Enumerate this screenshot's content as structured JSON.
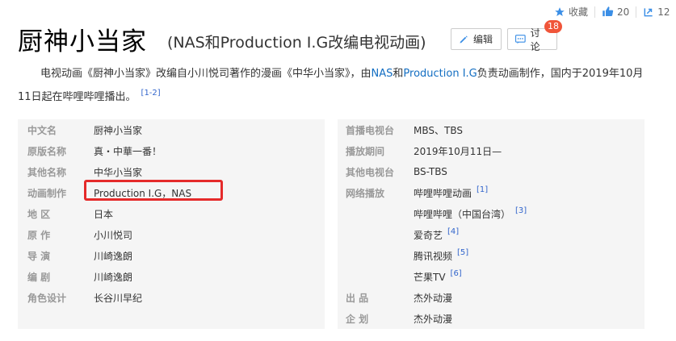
{
  "top_actions": {
    "favorite_label": "收藏",
    "like_count": "20",
    "share_count": "12"
  },
  "header": {
    "title": "厨神小当家",
    "subtitle": "(NAS和Production I.G改编电视动画)",
    "edit_label": "编辑",
    "discuss_label": "讨论",
    "discuss_badge": "18"
  },
  "summary": {
    "t1": "电视动画《厨神小当家》改编自小川悦司著作的漫画《中华小当家》，由",
    "link1": "NAS",
    "t2": "和",
    "link2": "Production I.G",
    "t3": "负责动画制作，国内于2019年10月11日起在哔哩哔哩播出。",
    "ref": "[1-2]"
  },
  "info": {
    "left": [
      {
        "key": "中文名",
        "value": "厨神小当家"
      },
      {
        "key": "原版名称",
        "value": "真・中華一番！"
      },
      {
        "key": "其他名称",
        "value": "中华小当家"
      },
      {
        "key": "动画制作",
        "value": "Production I.G，NAS"
      },
      {
        "key": "地 区",
        "value": "日本"
      },
      {
        "key": "原 作",
        "value": "小川悦司"
      },
      {
        "key": "导 演",
        "value": "川崎逸朗"
      },
      {
        "key": "编 剧",
        "value": "川崎逸朗"
      },
      {
        "key": "角色设计",
        "value": "长谷川早纪"
      }
    ],
    "right": [
      {
        "key": "首播电视台",
        "value": "MBS、TBS",
        "ref": ""
      },
      {
        "key": "播放期间",
        "value": "2019年10月11日—",
        "ref": ""
      },
      {
        "key": "其他电视台",
        "value": "BS-TBS",
        "ref": ""
      },
      {
        "key": "网络播放",
        "value": "哔哩哔哩动画",
        "ref": "[1]"
      },
      {
        "key": "",
        "value": "哔哩哔哩（中国台湾）",
        "ref": "[3]"
      },
      {
        "key": "",
        "value": "爱奇艺",
        "ref": "[4]"
      },
      {
        "key": "",
        "value": "腾讯视频",
        "ref": "[5]"
      },
      {
        "key": "",
        "value": "芒果TV",
        "ref": "[6]"
      },
      {
        "key": "出 品",
        "value": "杰外动漫",
        "ref": ""
      },
      {
        "key": "企 划",
        "value": "杰外动漫",
        "ref": ""
      }
    ]
  },
  "colors": {
    "link": "#136ec2",
    "highlight": "#e52a2a",
    "badge": "#f05539",
    "row_bg": "#f5f5f5",
    "key_text": "#999999"
  }
}
